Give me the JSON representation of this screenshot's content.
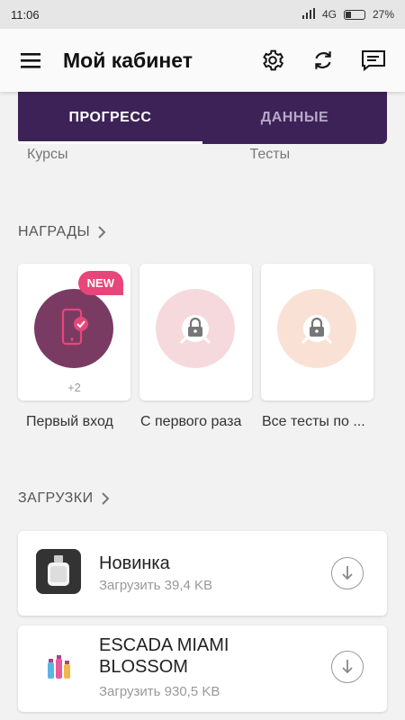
{
  "status": {
    "time": "11:06",
    "network": "4G",
    "battery": "27%",
    "battery_level": 0.27
  },
  "appbar": {
    "title": "Мой кабинет",
    "icons": [
      "menu-icon",
      "gear-icon",
      "sync-icon",
      "message-icon"
    ]
  },
  "tabs": [
    {
      "label": "ПРОГРЕСС",
      "active": true
    },
    {
      "label": "ДАННЫЕ",
      "active": false
    }
  ],
  "progress_labels": [
    "Курсы",
    "Тесты"
  ],
  "awards_section": {
    "title": "НАГРАДЫ"
  },
  "awards": [
    {
      "name": "Первый вход",
      "badge": "NEW",
      "count": "+2",
      "circle_color": "#7a3b63",
      "icon": "phone-check-icon",
      "locked": false
    },
    {
      "name": "С первого раза",
      "circle_color": "#f6d9dd",
      "icon": "lock-icon",
      "locked": true
    },
    {
      "name": "Все тесты по ...",
      "circle_color": "#f9e2d5",
      "icon": "lock-icon",
      "locked": true
    }
  ],
  "downloads_section": {
    "title": "ЗАГРУЗКИ"
  },
  "downloads": [
    {
      "title": "Новинка",
      "subtitle": "Загрузить 39,4 KB",
      "thumb_icon": "perfume-bottle-icon"
    },
    {
      "title": "ESCADA MIAMI BLOSSOM",
      "subtitle": "Загрузить 930,5 KB",
      "thumb_icon": "perfume-set-icon"
    }
  ],
  "colors": {
    "accent": "#3d2258",
    "badge": "#e8467a",
    "award_active": "#7a3b63"
  }
}
